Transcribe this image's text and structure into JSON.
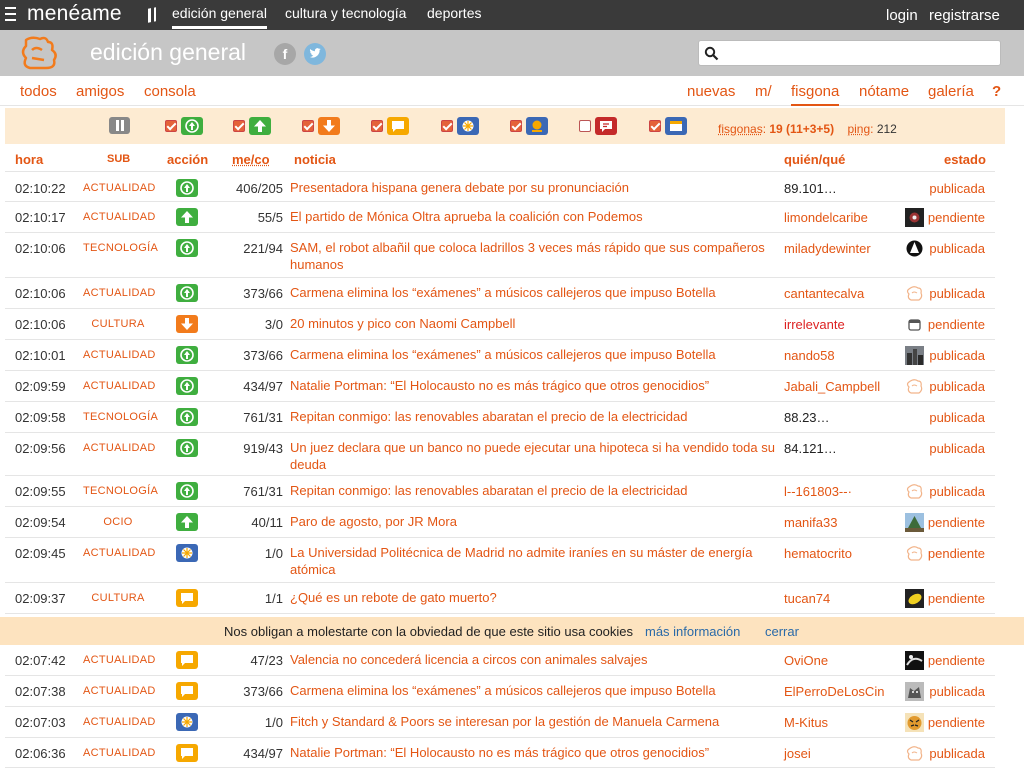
{
  "topbar": {
    "logo": "menéame",
    "nav": [
      {
        "label": "edición general",
        "active": true
      },
      {
        "label": "cultura y tecnología",
        "active": false
      },
      {
        "label": "deportes",
        "active": false
      }
    ],
    "login": "login",
    "register": "registrarse"
  },
  "header": {
    "title": "edición general",
    "facebook_glyph": "f",
    "search_placeholder": ""
  },
  "subnav": {
    "left": [
      "todos",
      "amigos",
      "consola"
    ],
    "right": [
      "nuevas",
      "m/",
      "fisgona",
      "nótame",
      "galería",
      "?"
    ],
    "active": "fisgona"
  },
  "filters": [
    {
      "name": "published",
      "checked": true,
      "icon": "published-icon",
      "color": "#3fae3f"
    },
    {
      "name": "vote",
      "checked": true,
      "icon": "vote-up-icon",
      "color": "#3fae3f"
    },
    {
      "name": "discard",
      "checked": true,
      "icon": "vote-down-icon",
      "color": "#f27b1c"
    },
    {
      "name": "comment",
      "checked": true,
      "icon": "comment-icon",
      "color": "#f6a800"
    },
    {
      "name": "new",
      "checked": true,
      "icon": "new-link-icon",
      "color": "#3b68b5"
    },
    {
      "name": "problem",
      "checked": true,
      "icon": "sun-icon",
      "color": "#f6a800"
    },
    {
      "name": "chat",
      "checked": false,
      "icon": "chat-icon",
      "color": "#c42a2a"
    },
    {
      "name": "post",
      "checked": true,
      "icon": "post-icon",
      "color": "#3b68b5"
    }
  ],
  "stats": {
    "fisgonas_label": "fisgonas",
    "fisgonas_value": "19 (11+3+5)",
    "ping_label": "ping",
    "ping_value": "212"
  },
  "columns": {
    "hora": "hora",
    "sub": "SUB",
    "accion": "acción",
    "meco": "me/co",
    "noticia": "noticia",
    "quien": "quién/qué",
    "estado": "estado"
  },
  "rows": [
    {
      "hora": "02:10:22",
      "sub": "ACTUALIDAD",
      "action": "published",
      "meco": "406/205",
      "news": "Presentadora hispana genera debate por su pronunciación",
      "user": "89.101…",
      "user_style": "black",
      "avatar": "",
      "estado": "publicada"
    },
    {
      "hora": "02:10:17",
      "sub": "ACTUALIDAD",
      "action": "vote",
      "meco": "55/5",
      "news": "El partido de Mónica Oltra aprueba la coalición con Podemos",
      "user": "limondelcaribe",
      "user_style": "orange",
      "avatar": "photo-dark",
      "estado": "pendiente"
    },
    {
      "hora": "02:10:06",
      "sub": "TECNOLOGÍA",
      "action": "published",
      "meco": "221/94",
      "news": "SAM, el robot albañil que coloca ladrillos 3 veces más rápido que sus compañeros humanos",
      "user": "miladydewinter",
      "user_style": "orange",
      "avatar": "emblem",
      "estado": "publicada"
    },
    {
      "hora": "02:10:06",
      "sub": "ACTUALIDAD",
      "action": "published",
      "meco": "373/66",
      "news": "Carmena elimina los “exámenes” a músicos callejeros que impuso Botella",
      "user": "cantantecalva",
      "user_style": "orange",
      "avatar": "default",
      "estado": "publicada"
    },
    {
      "hora": "02:10:06",
      "sub": "CULTURA",
      "action": "discard",
      "meco": "3/0",
      "news": "20 minutos y pico con Naomi Campbell",
      "user": "irrelevante",
      "user_style": "red",
      "avatar": "cup",
      "estado": "pendiente"
    },
    {
      "hora": "02:10:01",
      "sub": "ACTUALIDAD",
      "action": "published",
      "meco": "373/66",
      "news": "Carmena elimina los “exámenes” a músicos callejeros que impuso Botella",
      "user": "nando58",
      "user_style": "orange",
      "avatar": "photo-city",
      "estado": "publicada"
    },
    {
      "hora": "02:09:59",
      "sub": "ACTUALIDAD",
      "action": "published",
      "meco": "434/97",
      "news": "Natalie Portman: “El Holocausto no es más trágico que otros genocidios”",
      "user": "Jabali_Campbell",
      "user_style": "orange",
      "avatar": "default",
      "estado": "publicada"
    },
    {
      "hora": "02:09:58",
      "sub": "TECNOLOGÍA",
      "action": "published",
      "meco": "761/31",
      "news": "Repitan conmigo: las renovables abaratan el precio de la electricidad",
      "user": "88.23…",
      "user_style": "black",
      "avatar": "",
      "estado": "publicada"
    },
    {
      "hora": "02:09:56",
      "sub": "ACTUALIDAD",
      "action": "published",
      "meco": "919/43",
      "news": "Un juez declara que un banco no puede ejecutar una hipoteca si ha vendido toda su deuda",
      "user": "84.121…",
      "user_style": "black",
      "avatar": "",
      "estado": "publicada"
    },
    {
      "hora": "02:09:55",
      "sub": "TECNOLOGÍA",
      "action": "published",
      "meco": "761/31",
      "news": "Repitan conmigo: las renovables abaratan el precio de la electricidad",
      "user": "l--161803--·",
      "user_style": "orange",
      "avatar": "default",
      "estado": "publicada"
    },
    {
      "hora": "02:09:54",
      "sub": "OCIO",
      "action": "vote",
      "meco": "40/11",
      "news": "Paro de agosto, por JR Mora",
      "user": "manifa33",
      "user_style": "orange",
      "avatar": "photo-tree",
      "estado": "pendiente"
    },
    {
      "hora": "02:09:45",
      "sub": "ACTUALIDAD",
      "action": "new",
      "meco": "1/0",
      "news": "La Universidad Politécnica de Madrid no admite iraníes en su máster de energía atómica",
      "user": "hematocrito",
      "user_style": "orange",
      "avatar": "default",
      "estado": "pendiente"
    },
    {
      "hora": "02:09:37",
      "sub": "CULTURA",
      "action": "comment",
      "meco": "1/1",
      "news": "¿Qué es un rebote de gato muerto?",
      "user": "tucan74",
      "user_style": "orange",
      "avatar": "photo-yellow",
      "estado": "pendiente"
    },
    {
      "hora": "02:07:42",
      "sub": "ACTUALIDAD",
      "action": "comment",
      "meco": "47/23",
      "news": "Valencia no concederá licencia a circos con animales salvajes",
      "user": "OviOne",
      "user_style": "orange",
      "avatar": "photo-bw",
      "estado": "pendiente"
    },
    {
      "hora": "02:07:38",
      "sub": "ACTUALIDAD",
      "action": "comment",
      "meco": "373/66",
      "news": "Carmena elimina los “exámenes” a músicos callejeros que impuso Botella",
      "user": "ElPerroDeLosCin",
      "user_style": "orange",
      "avatar": "photo-dog",
      "estado": "publicada"
    },
    {
      "hora": "02:07:03",
      "sub": "ACTUALIDAD",
      "action": "new",
      "meco": "1/0",
      "news": "Fitch y Standard & Poors se interesan por la gestión de Manuela Carmena",
      "user": "M-Kitus",
      "user_style": "orange",
      "avatar": "photo-tiger",
      "estado": "pendiente"
    },
    {
      "hora": "02:06:36",
      "sub": "ACTUALIDAD",
      "action": "comment",
      "meco": "434/97",
      "news": "Natalie Portman: “El Holocausto no es más trágico que otros genocidios”",
      "user": "josei",
      "user_style": "orange",
      "avatar": "default",
      "estado": "publicada"
    }
  ],
  "cookie": {
    "text": "Nos obligan a molestarte con la obviedad de que este sitio usa cookies",
    "more": "más información",
    "close": "cerrar"
  },
  "colors": {
    "accent": "#e35614",
    "topbar": "#3a3a3a",
    "header": "#c6c6c6",
    "filterbar": "#fdebd2",
    "cookie": "#fde3bf"
  }
}
